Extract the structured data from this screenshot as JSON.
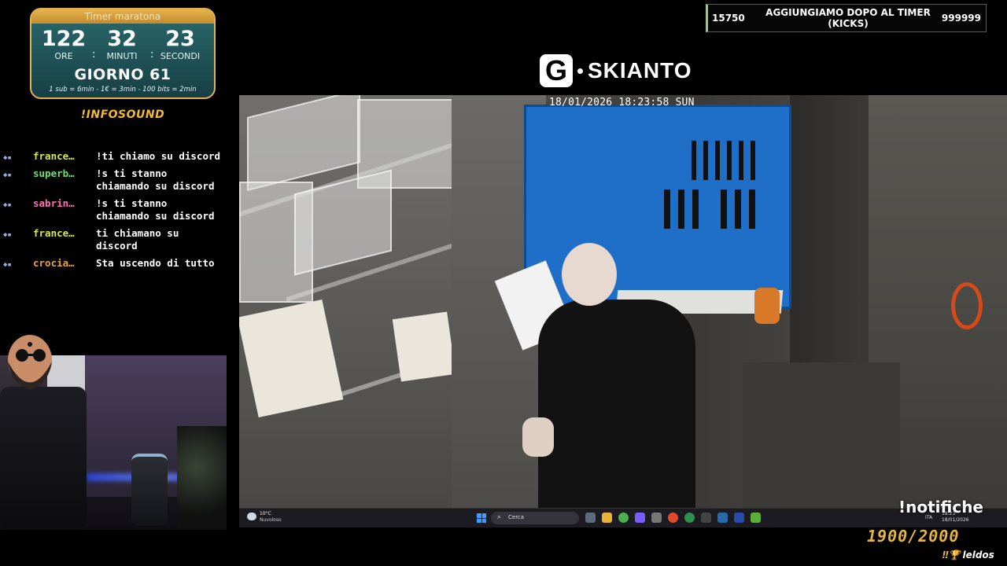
{
  "timer": {
    "title": "Timer maratona",
    "hours": "122",
    "minutes": "32",
    "seconds": "23",
    "hours_label": "ORE",
    "minutes_label": "MINUTI",
    "seconds_label": "SECONDI",
    "day": "GIORNO 61",
    "rates": "1 sub = 6min - 1€ = 3min - 100 bits = 2min"
  },
  "infosound": "!INFOSOUND",
  "chat": [
    {
      "user": "france…",
      "user_color": "#d6e94a",
      "text": "!ti chiamo su discord"
    },
    {
      "user": "superb…",
      "user_color": "#6be36b",
      "text": "!s ti stanno chiamando su discord"
    },
    {
      "user": "sabrin…",
      "user_color": "#ff6fb4",
      "text": "!s ti stanno chiamando su discord"
    },
    {
      "user": "france…",
      "user_color": "#d6e94a",
      "text": "ti chiamano su discord"
    },
    {
      "user": "crocia…",
      "user_color": "#e8a33d",
      "text": "Sta uscendo di tutto"
    }
  ],
  "topbar": {
    "left": "15750",
    "center": "AGGIUNGIAMO DOPO AL TIMER (KICKS)",
    "right": "999999"
  },
  "logo": {
    "letter": "G",
    "name": "SKIANTO"
  },
  "camera": {
    "timestamp": "18/01/2026 18:23:58 SUN"
  },
  "taskbar": {
    "temperature": "10°C",
    "weather": "Nuvoloso",
    "search_placeholder": "Cerca",
    "lang": "ITA",
    "time": "18:23",
    "date": "18/01/2026"
  },
  "overlay": {
    "notifiche": "!notifiche",
    "goal": "1900/2000",
    "ticker": "leldos"
  },
  "colors": {
    "timer_border": "#e2b24d",
    "goal": "#e5b640",
    "pegboard": "#1f6fc8"
  }
}
